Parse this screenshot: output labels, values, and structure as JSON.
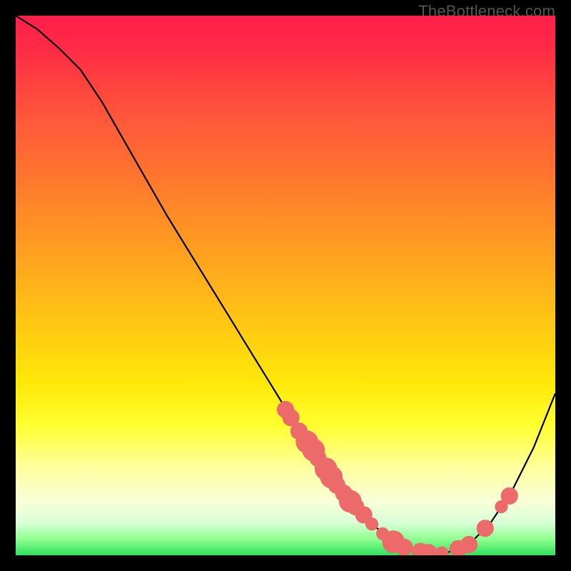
{
  "watermark": "TheBottleneck.com",
  "chart_data": {
    "type": "line",
    "title": "",
    "xlabel": "",
    "ylabel": "",
    "xlim": [
      0,
      100
    ],
    "ylim": [
      0,
      100
    ],
    "curve": [
      {
        "x": 0,
        "y": 100
      },
      {
        "x": 4,
        "y": 97.5
      },
      {
        "x": 8,
        "y": 94
      },
      {
        "x": 12,
        "y": 90
      },
      {
        "x": 16,
        "y": 84
      },
      {
        "x": 20,
        "y": 77
      },
      {
        "x": 24,
        "y": 70
      },
      {
        "x": 28,
        "y": 63
      },
      {
        "x": 32,
        "y": 56.5
      },
      {
        "x": 36,
        "y": 50
      },
      {
        "x": 40,
        "y": 43.5
      },
      {
        "x": 44,
        "y": 37
      },
      {
        "x": 48,
        "y": 30.5
      },
      {
        "x": 52,
        "y": 24
      },
      {
        "x": 56,
        "y": 18
      },
      {
        "x": 60,
        "y": 12.5
      },
      {
        "x": 64,
        "y": 8
      },
      {
        "x": 68,
        "y": 4
      },
      {
        "x": 72,
        "y": 1.5
      },
      {
        "x": 76,
        "y": 0.5
      },
      {
        "x": 80,
        "y": 0.5
      },
      {
        "x": 84,
        "y": 2
      },
      {
        "x": 88,
        "y": 6
      },
      {
        "x": 92,
        "y": 12
      },
      {
        "x": 96,
        "y": 20
      },
      {
        "x": 100,
        "y": 30
      }
    ],
    "clusters": [
      {
        "x": 50.0,
        "y": 27.0,
        "r": 1.6
      },
      {
        "x": 51.0,
        "y": 25.5,
        "r": 1.6
      },
      {
        "x": 52.5,
        "y": 23.0,
        "r": 1.6
      },
      {
        "x": 54.0,
        "y": 21.0,
        "r": 2.1
      },
      {
        "x": 55.2,
        "y": 19.5,
        "r": 2.1
      },
      {
        "x": 56.0,
        "y": 18.0,
        "r": 1.6
      },
      {
        "x": 57.5,
        "y": 16.0,
        "r": 2.1
      },
      {
        "x": 58.5,
        "y": 14.5,
        "r": 2.1
      },
      {
        "x": 59.5,
        "y": 13.0,
        "r": 1.6
      },
      {
        "x": 60.8,
        "y": 11.5,
        "r": 1.6
      },
      {
        "x": 62.0,
        "y": 10.0,
        "r": 2.1
      },
      {
        "x": 63.0,
        "y": 9.0,
        "r": 1.6
      },
      {
        "x": 64.5,
        "y": 7.5,
        "r": 1.6
      },
      {
        "x": 66.0,
        "y": 5.8,
        "r": 1.2
      },
      {
        "x": 68.0,
        "y": 4.0,
        "r": 1.2
      },
      {
        "x": 70.0,
        "y": 2.5,
        "r": 2.1
      },
      {
        "x": 72.0,
        "y": 1.5,
        "r": 1.6
      },
      {
        "x": 75.0,
        "y": 0.7,
        "r": 1.6
      },
      {
        "x": 76.5,
        "y": 0.5,
        "r": 1.6
      },
      {
        "x": 79.0,
        "y": 0.45,
        "r": 1.2
      },
      {
        "x": 82.0,
        "y": 1.2,
        "r": 1.6
      },
      {
        "x": 84.0,
        "y": 2.0,
        "r": 1.6
      },
      {
        "x": 87.0,
        "y": 5.0,
        "r": 1.6
      },
      {
        "x": 90.0,
        "y": 9.0,
        "r": 1.2
      },
      {
        "x": 91.5,
        "y": 11.0,
        "r": 1.6
      }
    ],
    "cluster_color": "#ed6a6a"
  }
}
